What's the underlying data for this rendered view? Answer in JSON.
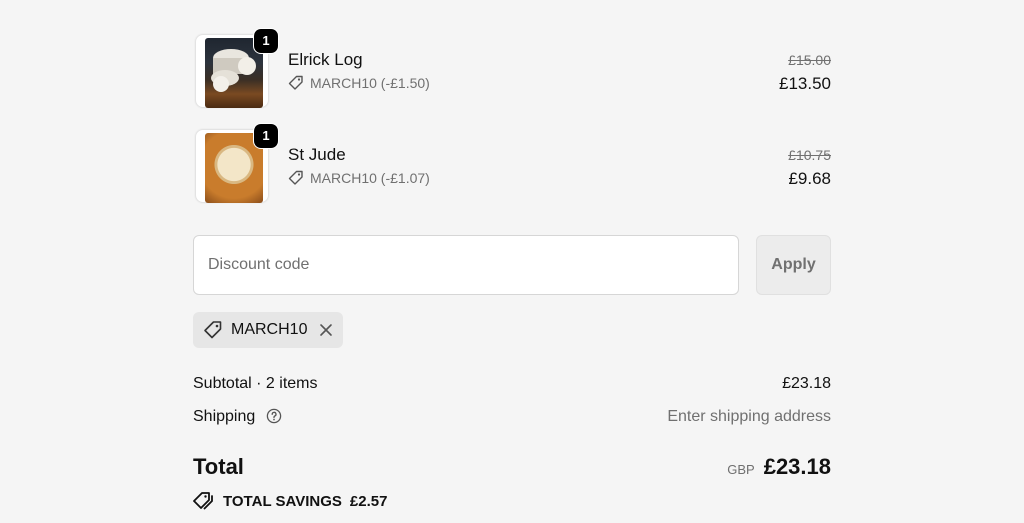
{
  "line_items": [
    {
      "name": "Elrick Log",
      "quantity": "1",
      "discount": "MARCH10 (-£1.50)",
      "original_price": "£15.00",
      "price": "£13.50",
      "image_icon": "cheese-log-photo"
    },
    {
      "name": "St Jude",
      "quantity": "1",
      "discount": "MARCH10 (-£1.07)",
      "original_price": "£10.75",
      "price": "£9.68",
      "image_icon": "round-cheese-photo"
    }
  ],
  "discount_form": {
    "placeholder": "Discount code",
    "value": "",
    "apply_label": "Apply"
  },
  "applied_code": {
    "code": "MARCH10",
    "icon": "tag-icon",
    "remove_icon": "close-icon"
  },
  "summary": {
    "subtotal_label": "Subtotal · 2 items",
    "subtotal_value": "£23.18",
    "shipping_label": "Shipping",
    "shipping_value": "Enter shipping address",
    "total_label": "Total",
    "currency": "GBP",
    "total_value": "£23.18",
    "savings_label": "TOTAL SAVINGS",
    "savings_value": "£2.57"
  },
  "colors": {
    "background": "#f5f5f5",
    "text": "#111111",
    "muted": "#707070",
    "badge": "#000000",
    "chip": "#e6e6e6"
  }
}
